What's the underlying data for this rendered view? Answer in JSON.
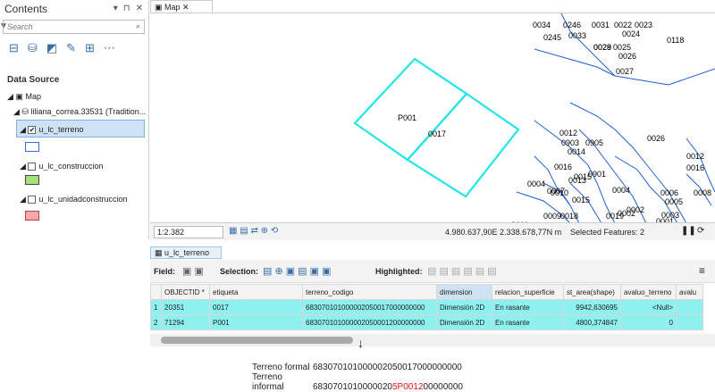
{
  "panel": {
    "title": "Contents",
    "buttons": [
      "▾",
      "⊓",
      "✕"
    ],
    "search_placeholder": "Search",
    "section_title": "Data Source",
    "tree": {
      "map": "Map",
      "db": "liliana_correa.33531 (Tradition...",
      "layer1": "u_lc_terreno",
      "layer2": "u_lc_construccion",
      "layer3": "u_lc_unidadconstruccion"
    },
    "colors": {
      "layer1": "#3b6fd8",
      "layer2": "#a6e27a",
      "layer3": "#f4a8a8"
    }
  },
  "map": {
    "tab": "Map",
    "scale": "1:2.382",
    "coords": "4.980.637,90E 2.338.678,77N m",
    "selected": "Selected Features: 2",
    "labels": [
      "0034",
      "0246",
      "0031",
      "0022",
      "0023",
      "0245",
      "0033",
      "0029",
      "0024",
      "0028",
      "0025",
      "0026",
      "0118",
      "0027",
      "P001",
      "0017",
      "0012",
      "0903",
      "0905",
      "0026",
      "0014",
      "0016",
      "0015",
      "0012",
      "0016",
      "0013",
      "0901",
      "0004",
      "0007",
      "0010",
      "0002",
      "0006",
      "0005",
      "0008",
      "0003",
      "0001",
      "0002",
      "0004",
      "0009",
      "0018",
      "0019",
      "0011",
      "0015"
    ]
  },
  "attr": {
    "tab": "u_lc_terreno",
    "toolbar": {
      "field": "Field:",
      "selection": "Selection:",
      "highlighted": "Highlighted:"
    },
    "columns": [
      "",
      "OBJECTID *",
      "etiqueta",
      "terreno_codigo",
      "dimension",
      "relacion_superficie",
      "st_area(shape)",
      "avaluo_terreno",
      "avalu"
    ],
    "rows": [
      [
        "1",
        "20351",
        "0017",
        "683070101000002050017000000000",
        "Dimensión 2D",
        "En rasante",
        "9942,630695",
        "<Null>"
      ],
      [
        "2",
        "71294",
        "P001",
        "683070101000002050001200000000",
        "Dimensión 2D",
        "En rasante",
        "4800,374847",
        "0"
      ]
    ]
  },
  "note": {
    "formal_label": "Terreno formal",
    "formal_code_a": "6830701010000020500170",
    "formal_code_b": "00000000",
    "informal_label": "Terreno informal",
    "informal_code_a": "6830701010000020",
    "informal_code_red": "5P0012",
    "informal_code_b": "00000000"
  }
}
